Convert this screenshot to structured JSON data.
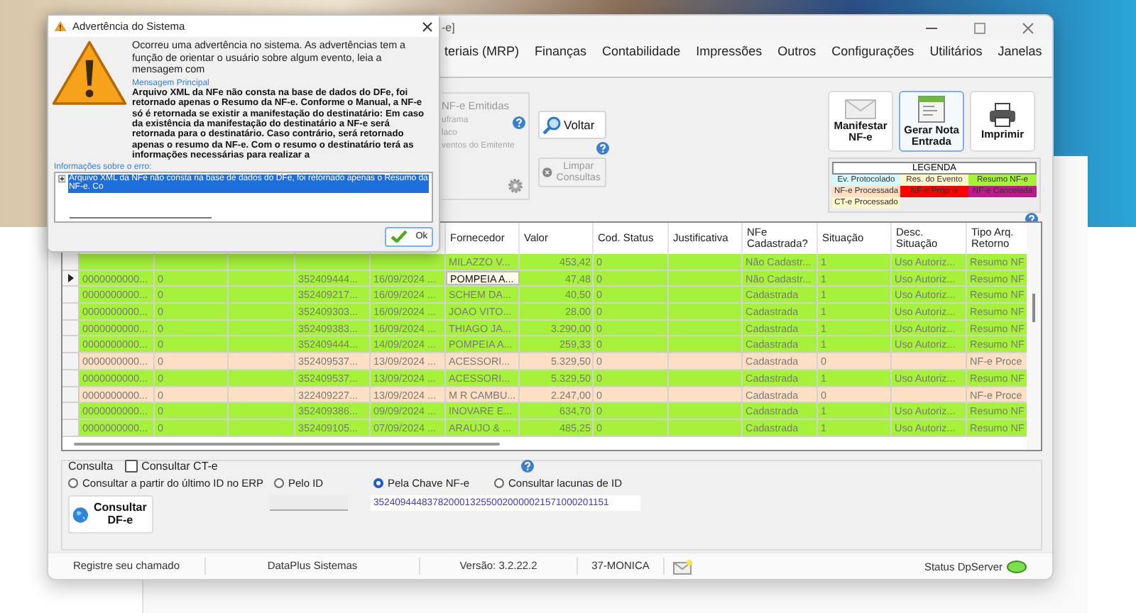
{
  "dialog": {
    "title": "Advertência do Sistema",
    "intro": "Ocorreu uma advertência no sistema. As advertências tem a função de orientar o usuário sobre algum evento, leia a mensagem com",
    "message_label": "Mensagem Principal",
    "message": "Arquivo XML da NFe não consta na base de dados do DFe, foi retornado apenas o Resumo da NF-e. Conforme o Manual, a NF-e só é retornada se existir a manifestação do destinatário: Em caso da existência da manifestação do destinatário a NF-e será retornada para o destinatário. Caso contrário, será retornado apenas o resumo da NF-e. Com o resumo o destinatário terá as informações necessárias para realizar a",
    "details_label": "Informações sobre o erro:",
    "details": [
      {
        "text": "Arquivo XML da NFe não consta na base de dados do DFe, foi retornado apenas o Resumo da NF-e. Co",
        "expanded": false,
        "selected": true
      }
    ],
    "ok": "Ok"
  },
  "window": {
    "title": "-e]"
  },
  "menu": [
    "teriais (MRP)",
    "Finanças",
    "Contabilidade",
    "Impressões",
    "Outros",
    "Configurações",
    "Utilitários",
    "Janelas"
  ],
  "emitidas": {
    "title": "NF-e Emitidas",
    "items": [
      "uframa",
      "laco",
      "ventos do Emitente"
    ]
  },
  "actions": [
    {
      "label": "Voltar",
      "kind": "search",
      "disabled": false
    },
    {
      "label": "Limpar Consultas",
      "kind": "clear",
      "disabled": true
    }
  ],
  "big_buttons": [
    {
      "label": "Manifestar NF-e",
      "kind": "mail",
      "focused": false
    },
    {
      "label": "Gerar Nota Entrada",
      "kind": "document",
      "focused": true
    },
    {
      "label": "Imprimir",
      "kind": "printer",
      "focused": false
    }
  ],
  "legend": {
    "title": "LEGENDA",
    "items": [
      {
        "label": "Ev. Protocolado",
        "color": "#d6f7fd"
      },
      {
        "label": "Res. do Evento",
        "color": "#fff6cc"
      },
      {
        "label": "Resumo NF-e",
        "color": "#a6f23a"
      },
      {
        "label": "NF-e Processada",
        "color": "#fde0c4"
      },
      {
        "label": "NF-e Própria",
        "color": "#ff0000"
      },
      {
        "label": "NF-e Cancelada",
        "color": "#c2188f"
      },
      {
        "label": "CT-e Processado",
        "color": "#fff6cc"
      }
    ]
  },
  "table": {
    "columns": [
      {
        "kind": "text"
      },
      {
        "kind": "text"
      },
      {
        "kind": "text"
      },
      {
        "kind": "text"
      },
      {
        "kind": "text"
      },
      {
        "label": "Fornecedor",
        "kind": "text",
        "current": true
      },
      {
        "label": "Valor",
        "kind": "number",
        "current": false
      },
      {
        "label": "Cod. Status",
        "kind": "text",
        "current": false
      },
      {
        "label": "Justificativa",
        "kind": "text",
        "current": false
      },
      {
        "label": "NFe Cadastrada?",
        "kind": "text",
        "current": false
      },
      {
        "label": "Situação",
        "kind": "text",
        "current": false
      },
      {
        "label": "Desc. Situação",
        "kind": "text",
        "current": false
      },
      {
        "label": "Tipo Arq. Retorno",
        "kind": "text",
        "current": false
      }
    ],
    "rows": [
      {
        "selected": false,
        "color": "#a6f23a",
        "cells": [
          null,
          null,
          null,
          null,
          null,
          "MILAZZO V...",
          "453,42",
          "0",
          null,
          "Não Cadastr...",
          "1",
          "Uso Autoriz...",
          "Resumo NF"
        ]
      },
      {
        "selected": true,
        "color": "#a6f23a",
        "cells": [
          "0000000000...",
          "0",
          null,
          "352409444...",
          "16/09/2024 ...",
          "POMPEIA A...",
          "47,48",
          "0",
          null,
          "Não Cadastr...",
          "1",
          "Uso Autoriz...",
          "Resumo NF"
        ]
      },
      {
        "selected": false,
        "color": "#a6f23a",
        "cells": [
          "0000000000...",
          "0",
          null,
          "352409217...",
          "16/09/2024 ...",
          "SCHEM DA...",
          "40,50",
          "0",
          null,
          "Cadastrada",
          "1",
          "Uso Autoriz...",
          "Resumo NF"
        ]
      },
      {
        "selected": false,
        "color": "#a6f23a",
        "cells": [
          "0000000000...",
          "0",
          null,
          "352409303...",
          "16/09/2024 ...",
          "JOAO VITO...",
          "28,00",
          "0",
          null,
          "Cadastrada",
          "1",
          "Uso Autoriz...",
          "Resumo NF"
        ]
      },
      {
        "selected": false,
        "color": "#a6f23a",
        "cells": [
          "0000000000...",
          "0",
          null,
          "352409383...",
          "16/09/2024 ...",
          "THIAGO JA...",
          "3.290,00",
          "0",
          null,
          "Cadastrada",
          "1",
          "Uso Autoriz...",
          "Resumo NF"
        ]
      },
      {
        "selected": false,
        "color": "#a6f23a",
        "cells": [
          "0000000000...",
          "0",
          null,
          "352409444...",
          "14/09/2024 ...",
          "POMPEIA A...",
          "259,33",
          "0",
          null,
          "Cadastrada",
          "1",
          "Uso Autoriz...",
          "Resumo NF"
        ]
      },
      {
        "selected": false,
        "color": "#fde0c4",
        "cells": [
          "0000000000...",
          "0",
          null,
          "352409537...",
          "13/09/2024 ...",
          "ACESSORI...",
          "5.329,50",
          "0",
          null,
          "Cadastrada",
          "0",
          null,
          "NF-e Proce"
        ]
      },
      {
        "selected": false,
        "color": "#a6f23a",
        "cells": [
          "0000000000...",
          "0",
          null,
          "352409537...",
          "13/09/2024 ...",
          "ACESSORI...",
          "5.329,50",
          "0",
          null,
          "Cadastrada",
          "1",
          "Uso Autoriz...",
          "Resumo NF"
        ]
      },
      {
        "selected": false,
        "color": "#fde0c4",
        "cells": [
          "0000000000...",
          "0",
          null,
          "322409227...",
          "13/09/2024 ...",
          "M R CAMBU...",
          "2.247,00",
          "0",
          null,
          "Cadastrada",
          "0",
          null,
          "NF-e Proce"
        ]
      },
      {
        "selected": false,
        "color": "#a6f23a",
        "cells": [
          "0000000000...",
          "0",
          null,
          "352409386...",
          "09/09/2024 ...",
          "INOVARE E...",
          "634,70",
          "0",
          null,
          "Cadastrada",
          "1",
          "Uso Autoriz...",
          "Resumo NF"
        ]
      },
      {
        "selected": false,
        "color": "#a6f23a",
        "cells": [
          "0000000000...",
          "0",
          null,
          "352409105...",
          "07/09/2024 ...",
          "ARAUJO & ...",
          "485,25",
          "0",
          null,
          "Cadastrada",
          "1",
          "Uso Autoriz...",
          "Resumo NF"
        ]
      }
    ]
  },
  "consulta": {
    "title": "Consulta",
    "ct_e": {
      "label": "Consultar CT-e",
      "checked": false
    },
    "options": [
      {
        "label": "Consultar a partir do último ID no ERP",
        "selected": false
      },
      {
        "label": "Pelo ID",
        "selected": false
      },
      {
        "label": "Pela Chave NF-e",
        "selected": true
      },
      {
        "label": "Consultar lacunas de ID",
        "selected": false
      }
    ],
    "button": "Consultar DF-e",
    "id_field": {
      "disabled": true
    },
    "key_field": {
      "value": "35240944483782000132550020000021571000201151"
    }
  },
  "status_bar": {
    "items": [
      "Registre seu chamado",
      "DataPlus Sistemas",
      "Versão: 3.2.22.2",
      "37-MONICA"
    ],
    "server": {
      "label": "Status DpServer",
      "on": true
    }
  }
}
